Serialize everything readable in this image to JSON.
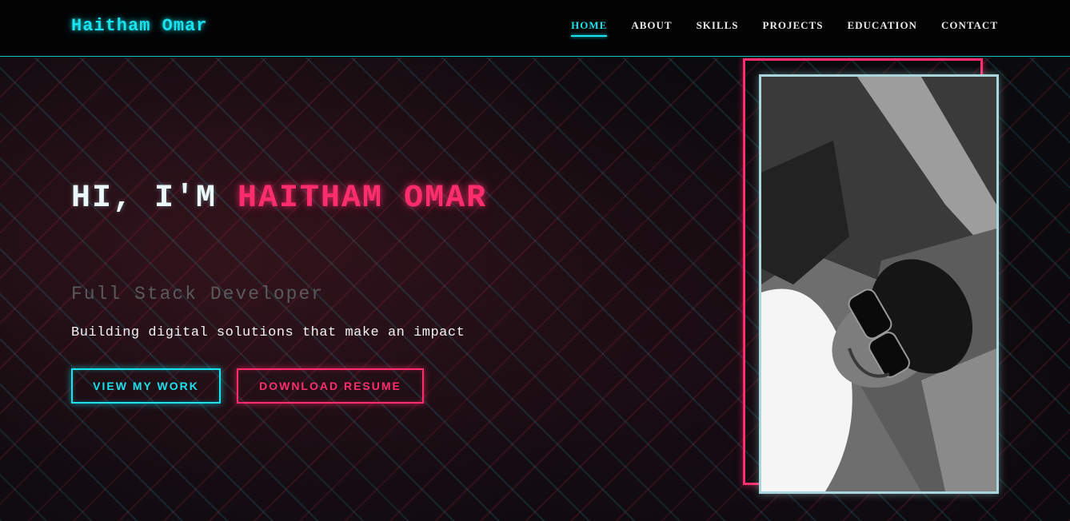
{
  "navbar": {
    "logo": "Haitham Omar",
    "links": [
      {
        "label": "HOME",
        "active": true
      },
      {
        "label": "ABOUT"
      },
      {
        "label": "SKILLS"
      },
      {
        "label": "PROJECTS"
      },
      {
        "label": "EDUCATION"
      },
      {
        "label": "CONTACT"
      }
    ]
  },
  "hero": {
    "greeting": "HI, I'M ",
    "name": "HAITHAM OMAR",
    "subtitle": "Full Stack Developer",
    "tagline": "Building digital solutions that make an impact",
    "primary_button": "VIEW MY WORK",
    "secondary_button": "DOWNLOAD RESUME"
  },
  "colors": {
    "accent_cyan": "#19e3ee",
    "accent_pink": "#ff2d6e",
    "background": "#0b0a0d"
  }
}
